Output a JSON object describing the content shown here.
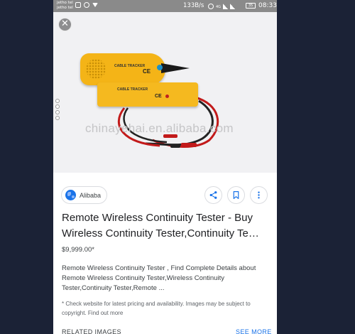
{
  "status_bar": {
    "carrier_line_1": "jetho tel",
    "carrier_line_2": "jetho tel",
    "net_speed": "133B/s",
    "network_badge": "4G",
    "battery": "35",
    "time": "08:33"
  },
  "image": {
    "watermark": "chinayehai.en.alibaba.com",
    "receiver_label": "CABLE TRACKER",
    "transmitter_label": "CABLE TRACKER",
    "ce_mark": "CE",
    "product_colors": {
      "body": "#f4b417",
      "tip": "#1a1a1a",
      "led": "#1b8fc7"
    }
  },
  "result": {
    "source": "Alibaba",
    "title": "Remote Wireless Continuity Tester - Buy Wireless Continuity Tester,Continuity Te…",
    "price": "$9,999.00*",
    "description": "Remote Wireless Continuity Tester , Find Complete Details about Remote Wireless Continuity Tester,Wireless Continuity Tester,Continuity Tester,Remote ...",
    "disclaimer": "* Check website for latest pricing and availability. Images may be subject to copyright. Find out more"
  },
  "related": {
    "heading": "RELATED IMAGES",
    "see_more": "SEE MORE"
  },
  "icons": {
    "close": "close-icon",
    "source": "globe-icon",
    "share": "share-icon",
    "save": "bookmark-icon",
    "more": "more-vert-icon"
  },
  "colors": {
    "accent": "#1a73e8",
    "background": "#1b2236"
  }
}
